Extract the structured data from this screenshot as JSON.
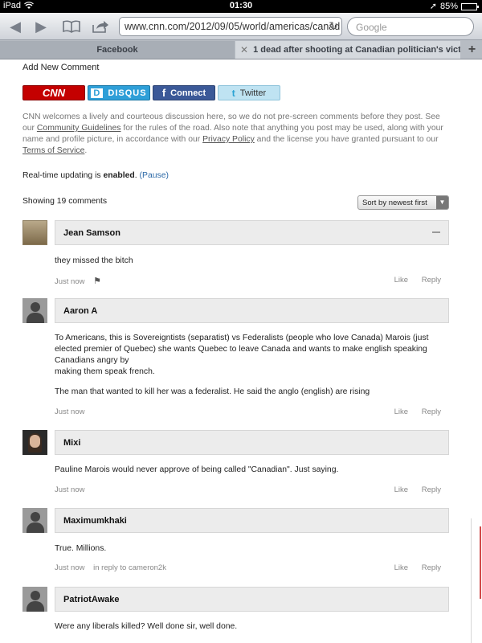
{
  "status_bar": {
    "carrier": "iPad",
    "time": "01:30",
    "battery": "85%",
    "battery_level": 0.85
  },
  "toolbar": {
    "url": "www.cnn.com/2012/09/05/world/americas/canad",
    "search_placeholder": "Google"
  },
  "tabs": [
    {
      "label": "Facebook"
    },
    {
      "label": "1 dead after shooting at Canadian politician's vict..."
    }
  ],
  "comments_section": {
    "title": "Add New Comment",
    "login_buttons": {
      "cnn": "CNN",
      "disqus_icon": "D",
      "disqus": "DISQUS",
      "facebook_icon": "f",
      "facebook": "Connect",
      "twitter_icon": "t",
      "twitter": "Twitter"
    },
    "intro": {
      "part1": "CNN welcomes a lively and courteous discussion here, so we do not pre-screen comments before they post. See our ",
      "link1": "Community Guidelines",
      "part2": " for the rules of the road. Also note that anything you post may be used, along with your name and profile picture, in accordance with our ",
      "link2": "Privacy Policy",
      "part3": " and the license you have granted pursuant to our ",
      "link3": "Terms of Service",
      "part4": "."
    },
    "realtime": {
      "prefix": "Real-time updating is ",
      "state": "enabled",
      "suffix": ". ",
      "pause": "(Pause)"
    },
    "showing": "Showing 19 comments",
    "sort_label": "Sort by newest first"
  },
  "comments": [
    {
      "author": "Jean Samson",
      "paragraphs": [
        "they missed the bitch"
      ],
      "time": "Just now",
      "like": "Like",
      "reply": "Reply"
    },
    {
      "author": "Aaron A",
      "paragraphs": [
        "To Americans, this is Sovereigntists (separatist) vs Federalists (people who love Canada) Marois (just elected premier of Quebec) she wants Quebec to leave Canada and wants to make english speaking Canadians angry by",
        "making them speak french.",
        "The man that wanted to kill her was a federalist. He said the anglo (english) are rising"
      ],
      "time": "Just now",
      "like": "Like",
      "reply": "Reply"
    },
    {
      "author": "Mixi",
      "paragraphs": [
        "Pauline Marois would never approve of being called \"Canadian\". Just saying."
      ],
      "time": "Just now",
      "like": "Like",
      "reply": "Reply"
    },
    {
      "author": "Maximumkhaki",
      "paragraphs": [
        "True.  Millions."
      ],
      "time": "Just now",
      "in_reply_to": "in reply to cameron2k",
      "like": "Like",
      "reply": "Reply"
    },
    {
      "author": "PatriotAwake",
      "paragraphs": [
        "Were any liberals killed?  Well done sir, well done."
      ]
    }
  ]
}
